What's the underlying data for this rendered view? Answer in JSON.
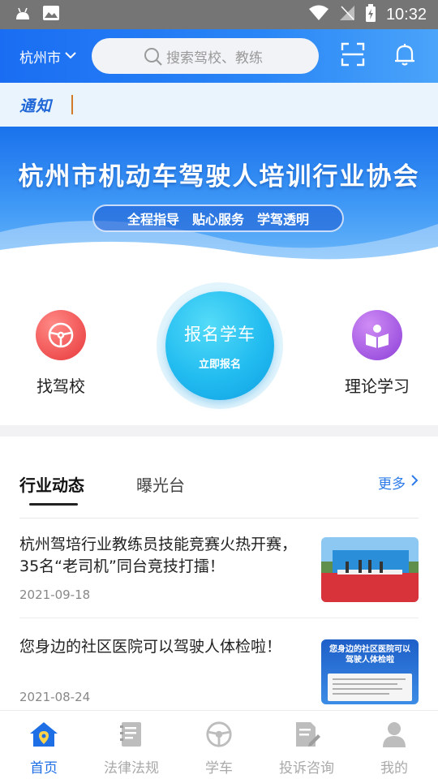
{
  "status_bar": {
    "time": "10:32"
  },
  "header": {
    "city": "杭州市",
    "search_placeholder": "搜索驾校、教练"
  },
  "notice": {
    "tag": "通知"
  },
  "banner": {
    "title": "杭州市机动车驾驶人培训行业协会",
    "slogans": [
      "全程指导",
      "贴心服务",
      "学驾透明"
    ]
  },
  "quick": {
    "left_label": "找驾校",
    "enroll_main": "报名学车",
    "enroll_sub": "立即报名",
    "right_label": "理论学习"
  },
  "news": {
    "tabs": [
      "行业动态",
      "曝光台"
    ],
    "more": "更多",
    "items": [
      {
        "title": "杭州驾培行业教练员技能竞赛火热开赛，35名“老司机”同台竞技打擂！",
        "date": "2021-09-18",
        "thumb_text": ""
      },
      {
        "title": "您身边的社区医院可以驾驶人体检啦！",
        "date": "2021-08-24",
        "thumb_text": "您身边的社区医院可以驾驶人体检啦"
      }
    ]
  },
  "tabbar": [
    {
      "label": "首页",
      "icon": "home-icon",
      "active": true
    },
    {
      "label": "法律法规",
      "icon": "book-icon",
      "active": false
    },
    {
      "label": "学车",
      "icon": "steering-wheel-icon",
      "active": false
    },
    {
      "label": "投诉咨询",
      "icon": "edit-document-icon",
      "active": false
    },
    {
      "label": "我的",
      "icon": "user-icon",
      "active": false
    }
  ],
  "colors": {
    "brand_blue": "#1e6fe6",
    "header_blue": "#1a6df2",
    "enroll_cyan": "#22bcf0",
    "red_icon": "#e8373a",
    "purple_icon": "#8d3fd8",
    "inactive_gray": "#a9a9a9"
  }
}
